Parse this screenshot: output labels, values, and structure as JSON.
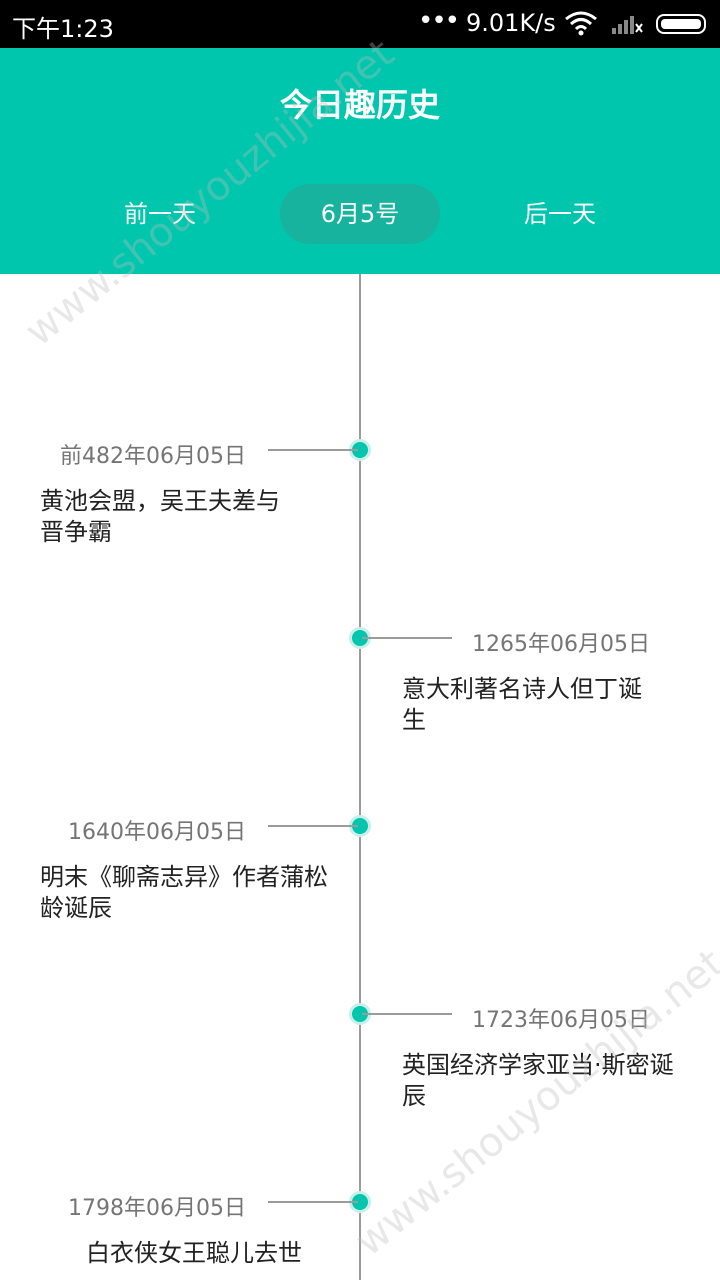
{
  "status_bar": {
    "time": "下午1:23",
    "dots": "•••",
    "network_speed": "9.01K/s"
  },
  "header": {
    "title": "今日趣历史",
    "prev_label": "前一天",
    "current_date": "6月5号",
    "next_label": "后一天"
  },
  "events": [
    {
      "date": "前482年06月05日",
      "text": "黄池会盟，吴王夫差与晋争霸"
    },
    {
      "date": "1265年06月05日",
      "text": "意大利著名诗人但丁诞生"
    },
    {
      "date": "1640年06月05日",
      "text": "明末《聊斋志异》作者蒲松龄诞辰"
    },
    {
      "date": "1723年06月05日",
      "text": "英国经济学家亚当·斯密诞辰"
    },
    {
      "date": "1798年06月05日",
      "text": "白衣侠女王聪儿去世"
    }
  ],
  "watermark": "www.shouyouzhijia.net",
  "colors": {
    "accent": "#00c6ad",
    "accent_dark": "#17b39e"
  }
}
